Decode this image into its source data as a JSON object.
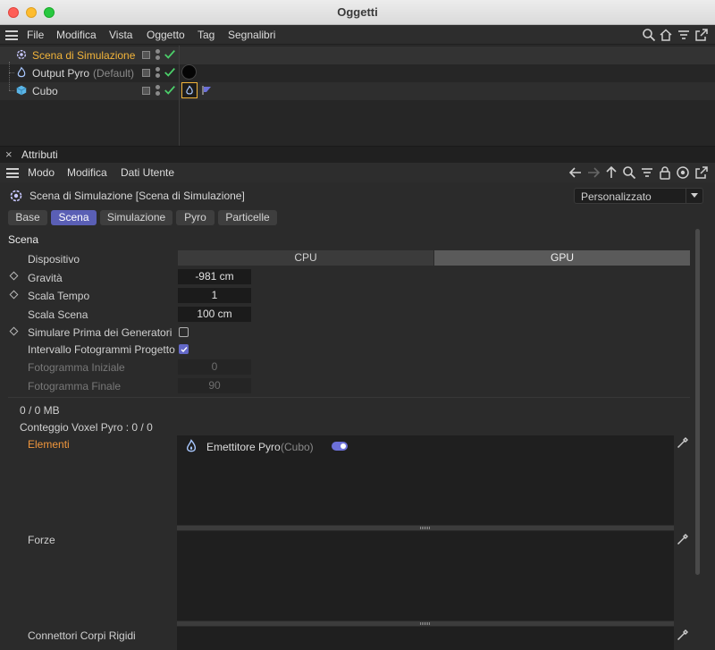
{
  "window": {
    "title": "Oggetti"
  },
  "menu": {
    "file": "File",
    "modifica": "Modifica",
    "vista": "Vista",
    "oggetto": "Oggetto",
    "tag": "Tag",
    "segnalibri": "Segnalibri"
  },
  "objects": [
    {
      "name": "Scena di Simulazione",
      "suffix": "",
      "color": "#f2b43a"
    },
    {
      "name": "Output Pyro",
      "suffix": "(Default)",
      "color": "#d4d4d4"
    },
    {
      "name": "Cubo",
      "suffix": "",
      "color": "#d4d4d4"
    }
  ],
  "attributes": {
    "panel_title": "Attributi",
    "menu": {
      "modo": "Modo",
      "modifica": "Modifica",
      "dati_utente": "Dati Utente"
    },
    "object_title": "Scena di Simulazione [Scena di Simulazione]",
    "preset": "Personalizzato",
    "tabs": [
      "Base",
      "Scena",
      "Simulazione",
      "Pyro",
      "Particelle"
    ],
    "active_tab": "Scena",
    "section": "Scena",
    "dispositivo": {
      "label": "Dispositivo",
      "cpu": "CPU",
      "gpu": "GPU",
      "selected": "GPU"
    },
    "gravita": {
      "label": "Gravità",
      "value": "-981 cm"
    },
    "scala_tempo": {
      "label": "Scala Tempo",
      "value": "1"
    },
    "scala_scena": {
      "label": "Scala Scena",
      "value": "100 cm"
    },
    "simulare": {
      "label": "Simulare Prima dei Generatori",
      "checked": false
    },
    "intervallo": {
      "label": "Intervallo Fotogrammi Progetto",
      "checked": true
    },
    "fotogramma_iniziale": {
      "label": "Fotogramma Iniziale",
      "value": "0"
    },
    "fotogramma_finale": {
      "label": "Fotogramma Finale",
      "value": "90"
    },
    "memory": "0 / 0 MB",
    "voxel": "Conteggio Voxel Pyro : 0 / 0",
    "elementi": {
      "label": "Elementi",
      "items": [
        {
          "name": "Emettitore Pyro",
          "parent": "(Cubo)",
          "enabled": true
        }
      ]
    },
    "forze": {
      "label": "Forze"
    },
    "connettori": {
      "label": "Connettori Corpi Rigidi"
    }
  },
  "colors": {
    "accent": "#5a5fb5",
    "highlight": "#f2b43a",
    "elementi_label": "#f0963c",
    "check": "#4bd06a"
  }
}
